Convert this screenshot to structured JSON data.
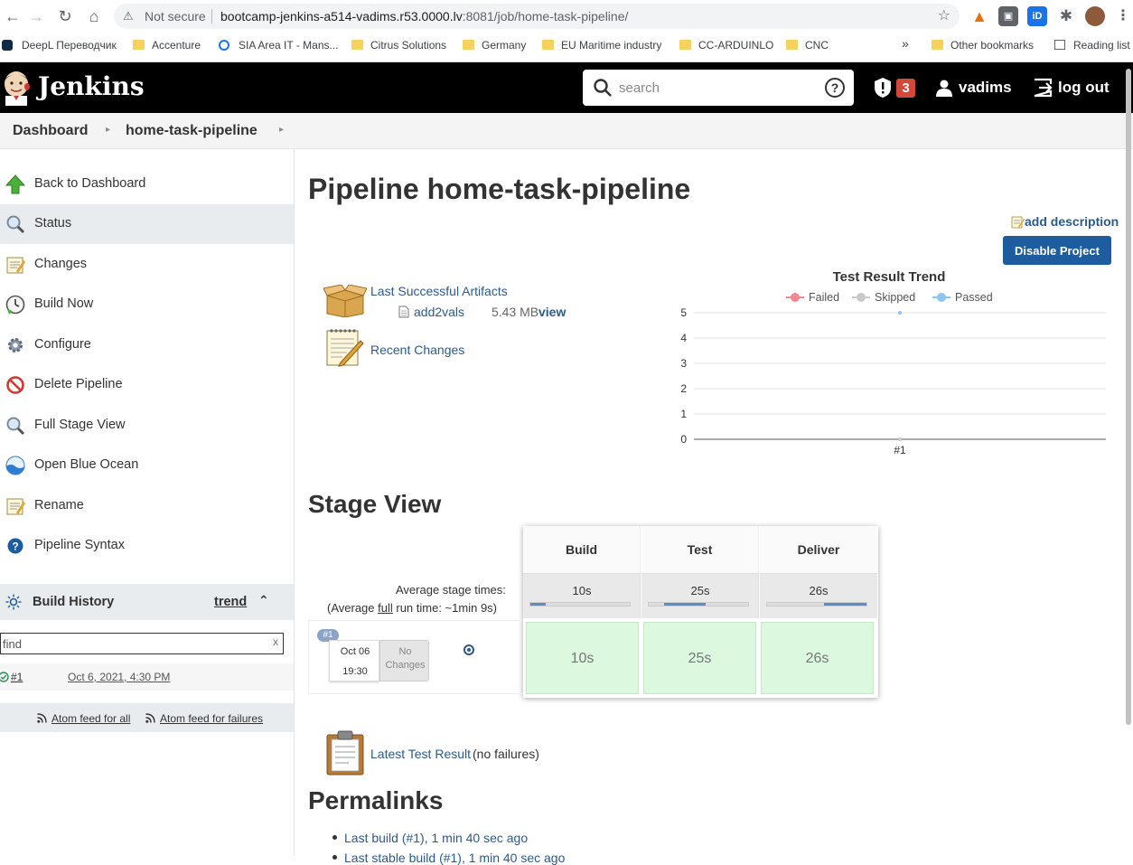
{
  "browser": {
    "not_secure": "Not secure",
    "url_host": "bootcamp-jenkins-a514-vadims.r53.0000.lv",
    "url_path": ":8081/job/home-task-pipeline/",
    "bookmarks": [
      "DeepL Переводчик",
      "Accenture",
      "SIA Area IT - Mans...",
      "Citrus Solutions",
      "Germany",
      "EU Maritime industry",
      "CC-ARDUINLO",
      "CNC"
    ],
    "more_bookmarks": "»",
    "other_bookmarks": "Other bookmarks",
    "reading_list": "Reading list"
  },
  "header": {
    "title": "Jenkins",
    "search_placeholder": "search",
    "alerts_count": "3",
    "user": "vadims",
    "logout": "log out"
  },
  "breadcrumb": {
    "items": [
      "Dashboard",
      "home-task-pipeline"
    ]
  },
  "sidebar": {
    "items": [
      {
        "label": "Back to Dashboard",
        "icon": "up-arrow-icon"
      },
      {
        "label": "Status",
        "icon": "magnifier-icon"
      },
      {
        "label": "Changes",
        "icon": "notepad-icon"
      },
      {
        "label": "Build Now",
        "icon": "clock-icon"
      },
      {
        "label": "Configure",
        "icon": "gear-icon"
      },
      {
        "label": "Delete Pipeline",
        "icon": "no-entry-icon"
      },
      {
        "label": "Full Stage View",
        "icon": "magnifier-icon"
      },
      {
        "label": "Open Blue Ocean",
        "icon": "blue-ocean-icon"
      },
      {
        "label": "Rename",
        "icon": "notepad-icon"
      },
      {
        "label": "Pipeline Syntax",
        "icon": "help-icon"
      }
    ],
    "active_index": 1,
    "build_history": {
      "title": "Build History",
      "trend": "trend",
      "find_placeholder": "find",
      "clear": "x",
      "builds": [
        {
          "number": "#1",
          "date": "Oct 6, 2021, 4:30 PM"
        }
      ],
      "feed_all": "Atom feed for all",
      "feed_failures": "Atom feed for failures"
    }
  },
  "main": {
    "title": "Pipeline home-task-pipeline",
    "add_description": "add description",
    "disable_button": "Disable Project",
    "artifacts_label": "Last Successful Artifacts",
    "artifact": {
      "name": "add2vals",
      "size": "5.43 MB",
      "view": "view"
    },
    "recent_changes": "Recent Changes",
    "stage_view_title": "Stage View",
    "avg_stage_times": "Average stage times:",
    "avg_full_prefix": "(Average ",
    "avg_full_link": "full",
    "avg_full_suffix": " run time: ~1min 9s)",
    "stages": [
      {
        "name": "Build",
        "avg": "10s",
        "bar_start": 0.0,
        "bar_len": 0.15
      },
      {
        "name": "Test",
        "avg": "25s",
        "bar_start": 0.15,
        "bar_len": 0.42
      },
      {
        "name": "Deliver",
        "avg": "26s",
        "bar_start": 0.57,
        "bar_len": 0.43
      }
    ],
    "run": {
      "number": "#1",
      "date": "Oct 06",
      "time": "19:30",
      "no_changes_1": "No",
      "no_changes_2": "Changes",
      "stage_times": [
        "10s",
        "25s",
        "26s"
      ]
    },
    "test_result_link": "Latest Test Result",
    "test_result_note": "(no failures)",
    "permalinks_title": "Permalinks",
    "permalinks": [
      "Last build (#1), 1 min 40 sec ago",
      "Last stable build (#1), 1 min 40 sec ago"
    ]
  },
  "chart_data": {
    "type": "line",
    "title": "Test Result Trend",
    "categories": [
      "#1"
    ],
    "series": [
      {
        "name": "Failed",
        "values": [
          0
        ],
        "color": "#ef8a91"
      },
      {
        "name": "Skipped",
        "values": [
          0
        ],
        "color": "#c9c9c9"
      },
      {
        "name": "Passed",
        "values": [
          5
        ],
        "color": "#8cc4f2"
      }
    ],
    "ylim": [
      0,
      5
    ],
    "yticks": [
      "0",
      "1",
      "2",
      "3",
      "4",
      "5"
    ],
    "legend": "top",
    "grid": true
  },
  "colors": {
    "header_bg": "#000000",
    "link": "#2c5a8c",
    "primary_button": "#1d5c9e",
    "stage_success": "#dcf8de",
    "alert_badge": "#d24939"
  }
}
